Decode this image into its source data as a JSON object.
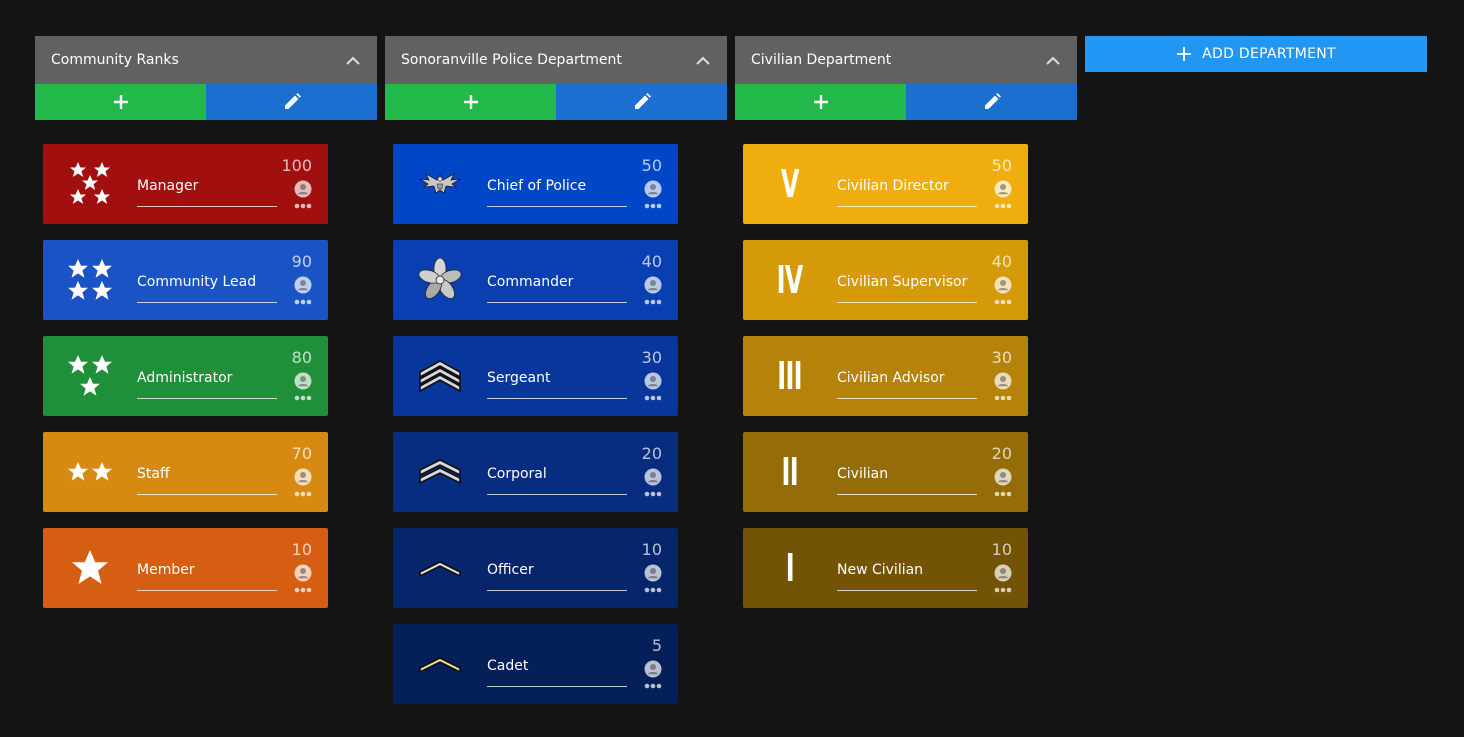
{
  "departments": [
    {
      "title": "Community Ranks",
      "ranks": [
        {
          "name": "Manager",
          "priority": "100",
          "color": "#a10f0f",
          "icon": "five-stars"
        },
        {
          "name": "Community Lead",
          "priority": "90",
          "color": "#1a54c4",
          "icon": "four-stars"
        },
        {
          "name": "Administrator",
          "priority": "80",
          "color": "#1f8f3a",
          "icon": "three-stars"
        },
        {
          "name": "Staff",
          "priority": "70",
          "color": "#d68a12",
          "icon": "two-stars"
        },
        {
          "name": "Member",
          "priority": "10",
          "color": "#d65e12",
          "icon": "one-star"
        }
      ]
    },
    {
      "title": "Sonoranville Police Department",
      "ranks": [
        {
          "name": "Chief of Police",
          "priority": "50",
          "color": "#0047c7",
          "icon": "eagle-insignia"
        },
        {
          "name": "Commander",
          "priority": "40",
          "color": "#0a3fb2",
          "icon": "oak-leaf-insignia"
        },
        {
          "name": "Sergeant",
          "priority": "30",
          "color": "#08369c",
          "icon": "three-chevrons"
        },
        {
          "name": "Corporal",
          "priority": "20",
          "color": "#072c80",
          "icon": "two-chevrons"
        },
        {
          "name": "Officer",
          "priority": "10",
          "color": "#06256b",
          "icon": "one-chevron"
        },
        {
          "name": "Cadet",
          "priority": "5",
          "color": "#052058",
          "icon": "single-chevron-gold"
        }
      ]
    },
    {
      "title": "Civilian Department",
      "ranks": [
        {
          "name": "Civilian Director",
          "priority": "50",
          "color": "#f0ad0e",
          "icon": "V"
        },
        {
          "name": "Civilian Supervisor",
          "priority": "40",
          "color": "#d49a0a",
          "icon": "IV"
        },
        {
          "name": "Civilian Advisor",
          "priority": "30",
          "color": "#b5830a",
          "icon": "III"
        },
        {
          "name": "Civilian",
          "priority": "20",
          "color": "#956d08",
          "icon": "II"
        },
        {
          "name": "New Civilian",
          "priority": "10",
          "color": "#735407",
          "icon": "I"
        }
      ]
    }
  ],
  "add_department": {
    "label": "ADD DEPARTMENT"
  },
  "colors": {
    "background": "#141414",
    "header": "#616161",
    "add_button": "#22b94a",
    "edit_button": "#1b6fd1",
    "add_department": "#2196f3"
  }
}
